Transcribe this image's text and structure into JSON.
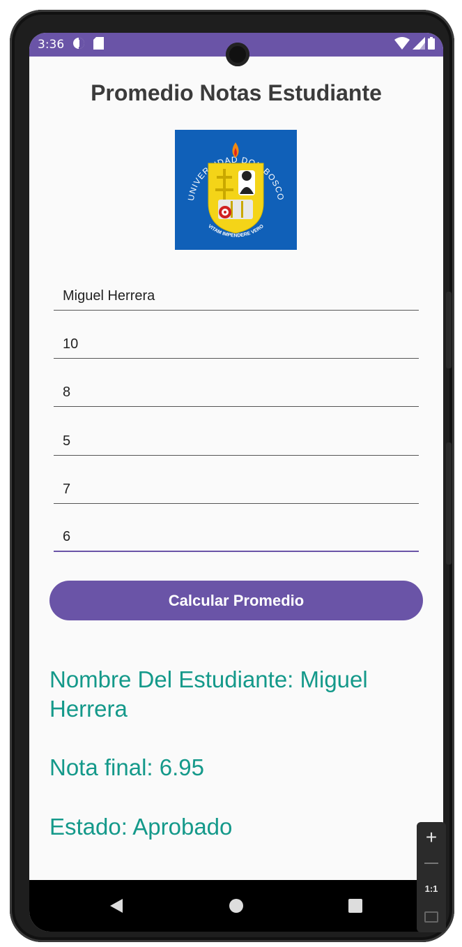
{
  "status_bar": {
    "time": "3:36"
  },
  "header": {
    "title": "Promedio Notas Estudiante"
  },
  "logo": {
    "top_text": "UNIVERSIDAD DON BOSCO",
    "bottom_text": "VITAM IMPENDERE VERO",
    "colors": {
      "background": "#1060b8",
      "shield": "#f4d418"
    }
  },
  "form": {
    "name_value": "Miguel Herrera",
    "grade1_value": "10",
    "grade2_value": "8",
    "grade3_value": "5",
    "grade4_value": "7",
    "grade5_value": "6"
  },
  "button": {
    "label": "Calcular Promedio"
  },
  "results": {
    "student_name": "Nombre Del Estudiante: Miguel Herrera",
    "final_grade": "Nota final: 6.95",
    "status": "Estado: Aprobado"
  },
  "zoom": {
    "in_label": "+",
    "reset_label": "1:1"
  },
  "colors": {
    "accent": "#6a54a7",
    "result_text": "#14998a"
  }
}
